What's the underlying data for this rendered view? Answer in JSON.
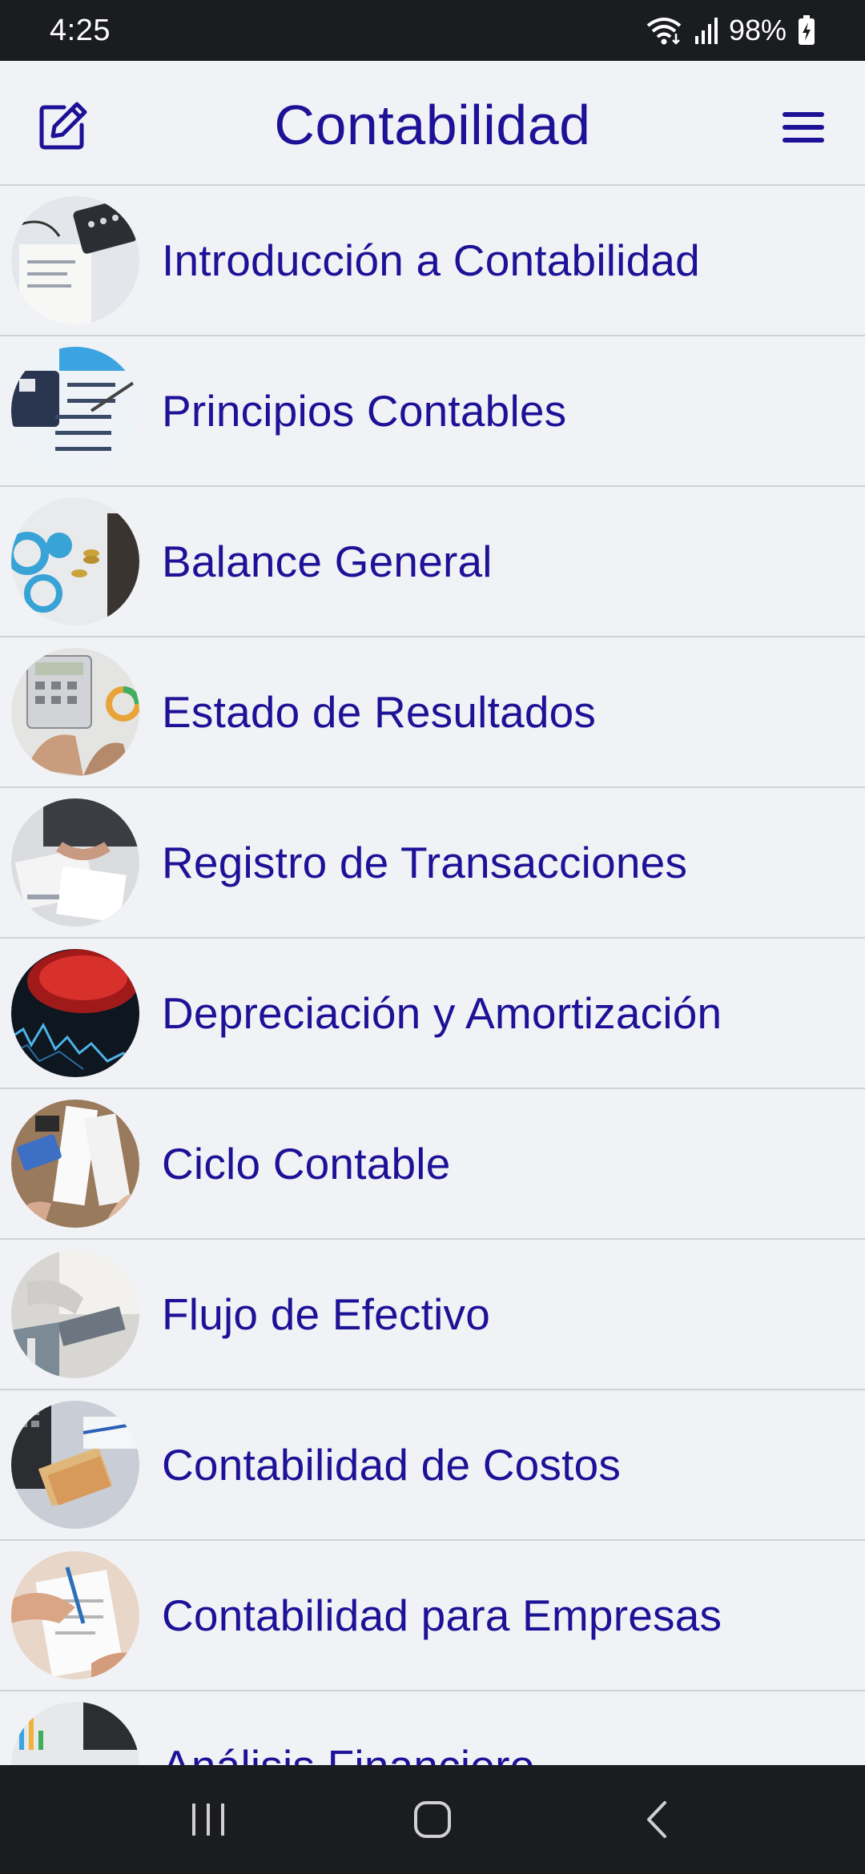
{
  "status_bar": {
    "time": "4:25",
    "battery": "98%",
    "icons": [
      "wifi-icon",
      "signal-icon",
      "battery-charging-icon"
    ]
  },
  "header": {
    "title": "Contabilidad",
    "left_icon": "edit-icon",
    "right_icon": "menu-icon"
  },
  "colors": {
    "accent": "#1d1297",
    "background": "#f1f2f6",
    "bars": "#1a1c20",
    "divider": "#cfd1d6"
  },
  "topics": [
    {
      "label": "Introducción a Contabilidad"
    },
    {
      "label": "Principios Contables"
    },
    {
      "label": "Balance General"
    },
    {
      "label": "Estado de Resultados"
    },
    {
      "label": "Registro de Transacciones"
    },
    {
      "label": "Depreciación y Amortización"
    },
    {
      "label": "Ciclo Contable"
    },
    {
      "label": "Flujo de Efectivo"
    },
    {
      "label": "Contabilidad de Costos"
    },
    {
      "label": "Contabilidad para Empresas"
    },
    {
      "label": "Análisis Financiero"
    }
  ],
  "nav": [
    "recents-icon",
    "home-icon",
    "back-icon"
  ]
}
